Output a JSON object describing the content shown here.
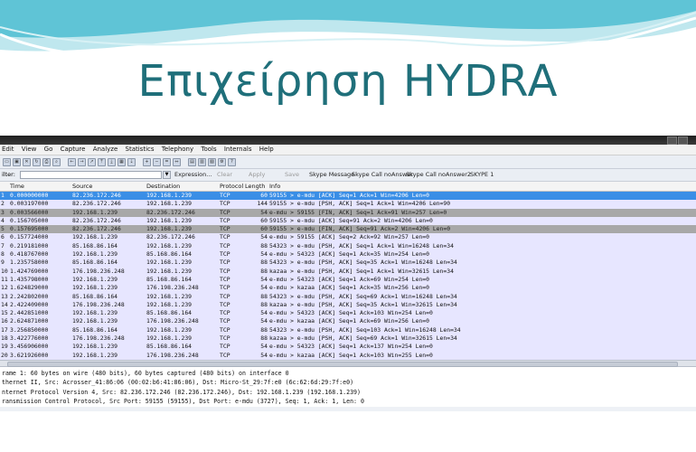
{
  "slide": {
    "title": "Επιχείρηση HYDRA",
    "colors": {
      "wave_dark": "#5fc4d6",
      "wave_light": "#bfe7ee",
      "title": "#1f6f7a"
    }
  },
  "wireshark": {
    "menu": [
      "Edit",
      "View",
      "Go",
      "Capture",
      "Analyze",
      "Statistics",
      "Telephony",
      "Tools",
      "Internals",
      "Help"
    ],
    "toolbar_icons": [
      "open-icon",
      "save-icon",
      "close-icon",
      "reload-icon",
      "print-icon",
      "find-icon",
      "back-icon",
      "forward-icon",
      "goto-icon",
      "top-icon",
      "bottom-icon",
      "colorize-icon",
      "autoscroll-icon",
      "zoom-in-icon",
      "zoom-out-icon",
      "zoom-normal-icon",
      "resize-columns-icon",
      "capture-filters-icon",
      "display-filters-icon",
      "coloring-rules-icon",
      "preferences-icon",
      "help-icon"
    ],
    "filter": {
      "label": "ilter:",
      "value": "",
      "buttons": [
        "Expression...",
        "Clear",
        "Apply",
        "Save",
        "Skype Message",
        "Skype Call noAnswer",
        "Skype Call noAnswer2",
        "SKYPE 1"
      ]
    },
    "columns": [
      "Time",
      "Source",
      "Destination",
      "Protocol",
      "Length",
      "Info"
    ],
    "packets": [
      {
        "no": "1",
        "time": "0.000000000",
        "src": "82.236.172.246",
        "dst": "192.168.1.239",
        "proto": "TCP",
        "len": "60",
        "info": "59155 > e-mdu [ACK] Seq=1 Ack=1 Win=4206 Len=0",
        "style": "sel"
      },
      {
        "no": "2",
        "time": "0.003197000",
        "src": "82.236.172.246",
        "dst": "192.168.1.239",
        "proto": "TCP",
        "len": "144",
        "info": "59155 > e-mdu [PSH, ACK] Seq=1 Ack=1 Win=4206 Len=90",
        "style": "tcp"
      },
      {
        "no": "3",
        "time": "0.003566000",
        "src": "192.168.1.239",
        "dst": "82.236.172.246",
        "proto": "TCP",
        "len": "54",
        "info": "e-mdu > 59155 [FIN, ACK] Seq=1 Ack=91 Win=257 Len=0",
        "style": "fin"
      },
      {
        "no": "4",
        "time": "0.156705000",
        "src": "82.236.172.246",
        "dst": "192.168.1.239",
        "proto": "TCP",
        "len": "60",
        "info": "59155 > e-mdu [ACK] Seq=91 Ack=2 Win=4206 Len=0",
        "style": "tcp"
      },
      {
        "no": "5",
        "time": "0.157695000",
        "src": "82.236.172.246",
        "dst": "192.168.1.239",
        "proto": "TCP",
        "len": "60",
        "info": "59155 > e-mdu [FIN, ACK] Seq=91 Ack=2 Win=4206 Len=0",
        "style": "fin"
      },
      {
        "no": "6",
        "time": "0.157724000",
        "src": "192.168.1.239",
        "dst": "82.236.172.246",
        "proto": "TCP",
        "len": "54",
        "info": "e-mdu > 59155 [ACK] Seq=2 Ack=92 Win=257 Len=0",
        "style": "tcp"
      },
      {
        "no": "7",
        "time": "0.219181000",
        "src": "85.168.86.164",
        "dst": "192.168.1.239",
        "proto": "TCP",
        "len": "88",
        "info": "54323 > e-mdu [PSH, ACK] Seq=1 Ack=1 Win=16248 Len=34",
        "style": "tcp"
      },
      {
        "no": "8",
        "time": "0.418767000",
        "src": "192.168.1.239",
        "dst": "85.168.86.164",
        "proto": "TCP",
        "len": "54",
        "info": "e-mdu > 54323 [ACK] Seq=1 Ack=35 Win=254 Len=0",
        "style": "tcp"
      },
      {
        "no": "9",
        "time": "1.235758000",
        "src": "85.168.86.164",
        "dst": "192.168.1.239",
        "proto": "TCP",
        "len": "88",
        "info": "54323 > e-mdu [PSH, ACK] Seq=35 Ack=1 Win=16248 Len=34",
        "style": "tcp"
      },
      {
        "no": "10",
        "time": "1.424769000",
        "src": "176.198.236.248",
        "dst": "192.168.1.239",
        "proto": "TCP",
        "len": "88",
        "info": "kazaa > e-mdu [PSH, ACK] Seq=1 Ack=1 Win=32615 Len=34",
        "style": "tcp"
      },
      {
        "no": "11",
        "time": "1.435798000",
        "src": "192.168.1.239",
        "dst": "85.168.86.164",
        "proto": "TCP",
        "len": "54",
        "info": "e-mdu > 54323 [ACK] Seq=1 Ack=69 Win=254 Len=0",
        "style": "tcp"
      },
      {
        "no": "12",
        "time": "1.624829000",
        "src": "192.168.1.239",
        "dst": "176.198.236.248",
        "proto": "TCP",
        "len": "54",
        "info": "e-mdu > kazaa [ACK] Seq=1 Ack=35 Win=256 Len=0",
        "style": "tcp"
      },
      {
        "no": "13",
        "time": "2.242802000",
        "src": "85.168.86.164",
        "dst": "192.168.1.239",
        "proto": "TCP",
        "len": "88",
        "info": "54323 > e-mdu [PSH, ACK] Seq=69 Ack=1 Win=16248 Len=34",
        "style": "tcp"
      },
      {
        "no": "14",
        "time": "2.422409000",
        "src": "176.198.236.248",
        "dst": "192.168.1.239",
        "proto": "TCP",
        "len": "88",
        "info": "kazaa > e-mdu [PSH, ACK] Seq=35 Ack=1 Win=32615 Len=34",
        "style": "tcp"
      },
      {
        "no": "15",
        "time": "2.442851000",
        "src": "192.168.1.239",
        "dst": "85.168.86.164",
        "proto": "TCP",
        "len": "54",
        "info": "e-mdu > 54323 [ACK] Seq=1 Ack=103 Win=254 Len=0",
        "style": "tcp"
      },
      {
        "no": "16",
        "time": "2.624871000",
        "src": "192.168.1.239",
        "dst": "176.198.236.248",
        "proto": "TCP",
        "len": "54",
        "info": "e-mdu > kazaa [ACK] Seq=1 Ack=69 Win=256 Len=0",
        "style": "tcp"
      },
      {
        "no": "17",
        "time": "3.256850000",
        "src": "85.168.86.164",
        "dst": "192.168.1.239",
        "proto": "TCP",
        "len": "88",
        "info": "54323 > e-mdu [PSH, ACK] Seq=103 Ack=1 Win=16248 Len=34",
        "style": "tcp"
      },
      {
        "no": "18",
        "time": "3.422776000",
        "src": "176.198.236.248",
        "dst": "192.168.1.239",
        "proto": "TCP",
        "len": "88",
        "info": "kazaa > e-mdu [PSH, ACK] Seq=69 Ack=1 Win=32615 Len=34",
        "style": "tcp"
      },
      {
        "no": "19",
        "time": "3.456906000",
        "src": "192.168.1.239",
        "dst": "85.168.86.164",
        "proto": "TCP",
        "len": "54",
        "info": "e-mdu > 54323 [ACK] Seq=1 Ack=137 Win=254 Len=0",
        "style": "tcp"
      },
      {
        "no": "20",
        "time": "3.621926000",
        "src": "192.168.1.239",
        "dst": "176.198.236.248",
        "proto": "TCP",
        "len": "54",
        "info": "e-mdu > kazaa [ACK] Seq=1 Ack=103 Win=255 Len=0",
        "style": "tcp"
      },
      {
        "no": "21",
        "time": "4.272089000",
        "src": "85.168.86.164",
        "dst": "192.168.1.239",
        "proto": "TCP",
        "len": "88",
        "info": "54323 > e-mdu [PSH, ACK] Seq=137 Ack=1 Win=16248 Len=34",
        "style": "tcp"
      }
    ],
    "details": [
      "rame 1: 60 bytes on wire (480 bits), 60 bytes captured (480 bits) on interface 0",
      "thernet II, Src: Acrosser_41:86:06 (00:02:b6:41:86:06), Dst: Micro-St_29:7f:e0 (6c:62:6d:29:7f:e0)",
      "nternet Protocol Version 4, Src: 82.236.172.246 (82.236.172.246), Dst: 192.168.1.239 (192.168.1.239)",
      "ransmission Control Protocol, Src Port: 59155 (59155), Dst Port: e-mdu (3727), Seq: 1, Ack: 1, Len: 0"
    ],
    "colors": {
      "selected": "#3a8ee6",
      "tcp_row": "#e7e6ff",
      "fin_row": "#a8a8a8"
    }
  }
}
